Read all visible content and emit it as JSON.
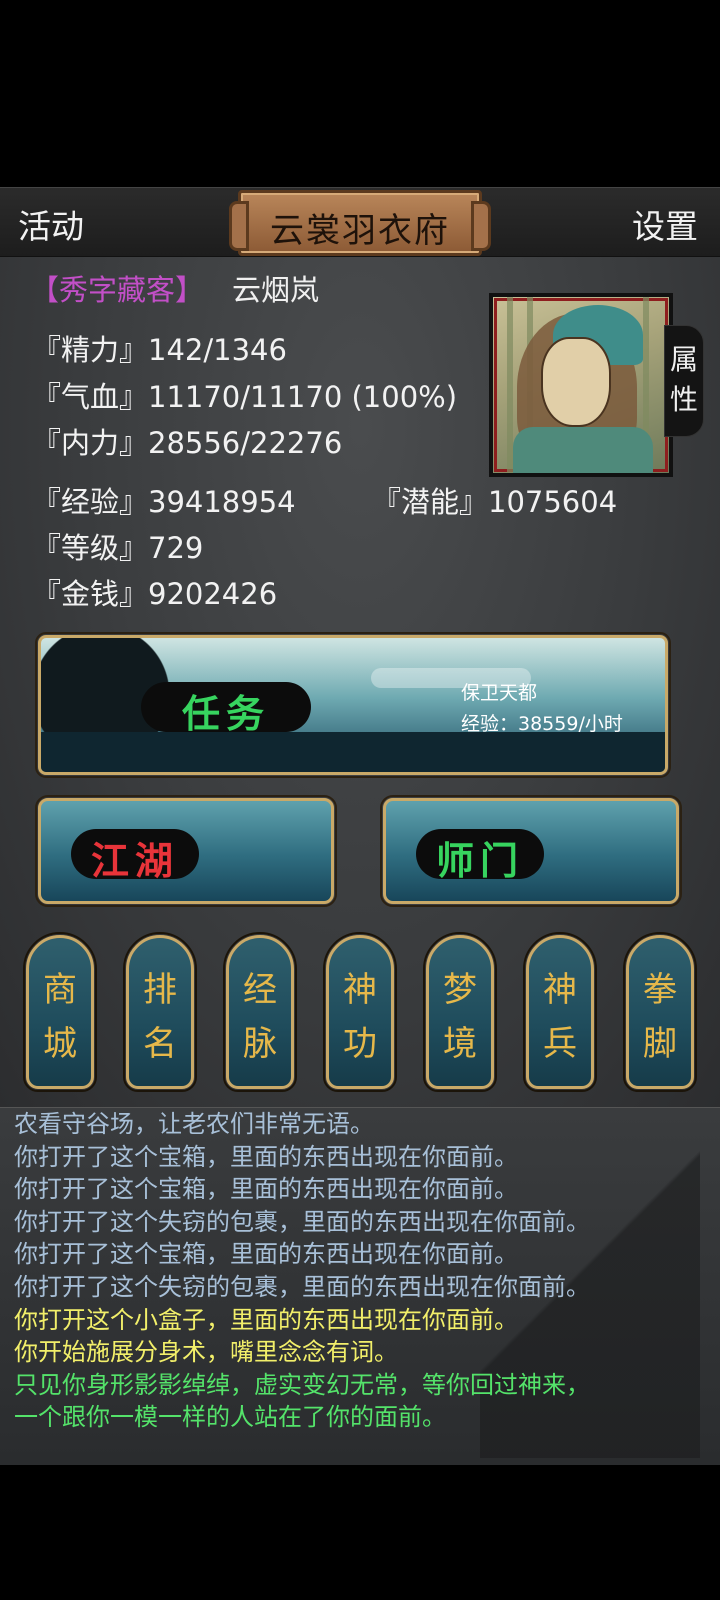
{
  "header": {
    "activity_label": "活动",
    "title": "云裳羽衣府",
    "settings_label": "设置"
  },
  "profile": {
    "title_tag": "【秀字藏客】",
    "name": "云烟岚",
    "stats": {
      "energy": "『精力』142/1346",
      "hp": "『气血』11170/11170 (100%)",
      "inner_power": "『内力』28556/22276",
      "experience": "『经验』39418954",
      "potential": "『潜能』1075604",
      "level": "『等级』729",
      "money": "『金钱』9202426"
    },
    "attributes_tab": "属性"
  },
  "mission": {
    "label": "任务",
    "name": "保卫天都",
    "rate": "经验：38559/小时"
  },
  "buttons": {
    "jianghu": "江湖",
    "shimen": "师门"
  },
  "menu": [
    {
      "c1": "商",
      "c2": "城"
    },
    {
      "c1": "排",
      "c2": "名"
    },
    {
      "c1": "经",
      "c2": "脉"
    },
    {
      "c1": "神",
      "c2": "功"
    },
    {
      "c1": "梦",
      "c2": "境"
    },
    {
      "c1": "神",
      "c2": "兵"
    },
    {
      "c1": "拳",
      "c2": "脚"
    }
  ],
  "log": [
    {
      "text": "农看守谷场，让老农们非常无语。",
      "color": "#a8c0d8"
    },
    {
      "text": "你打开了这个宝箱，里面的东西出现在你面前。",
      "color": "#a8c0d8"
    },
    {
      "text": "你打开了这个宝箱，里面的东西出现在你面前。",
      "color": "#a8c0d8"
    },
    {
      "text": "你打开了这个失窃的包裹，里面的东西出现在你面前。",
      "color": "#a8c0d8"
    },
    {
      "text": "你打开了这个宝箱，里面的东西出现在你面前。",
      "color": "#a8c0d8"
    },
    {
      "text": "你打开了这个失窃的包裹，里面的东西出现在你面前。",
      "color": "#a8c0d8"
    },
    {
      "text": "你打开这个小盒子，里面的东西出现在你面前。",
      "color": "#f2ef6a"
    },
    {
      "text": "你开始施展分身术，嘴里念念有词。",
      "color": "#f2ef6a"
    },
    {
      "text": "只见你身形影影绰绰，虚实变幻无常，等你回过神来，",
      "color": "#54e36a"
    },
    {
      "text": "一个跟你一模一样的人站在了你的面前。",
      "color": "#54e36a"
    }
  ]
}
